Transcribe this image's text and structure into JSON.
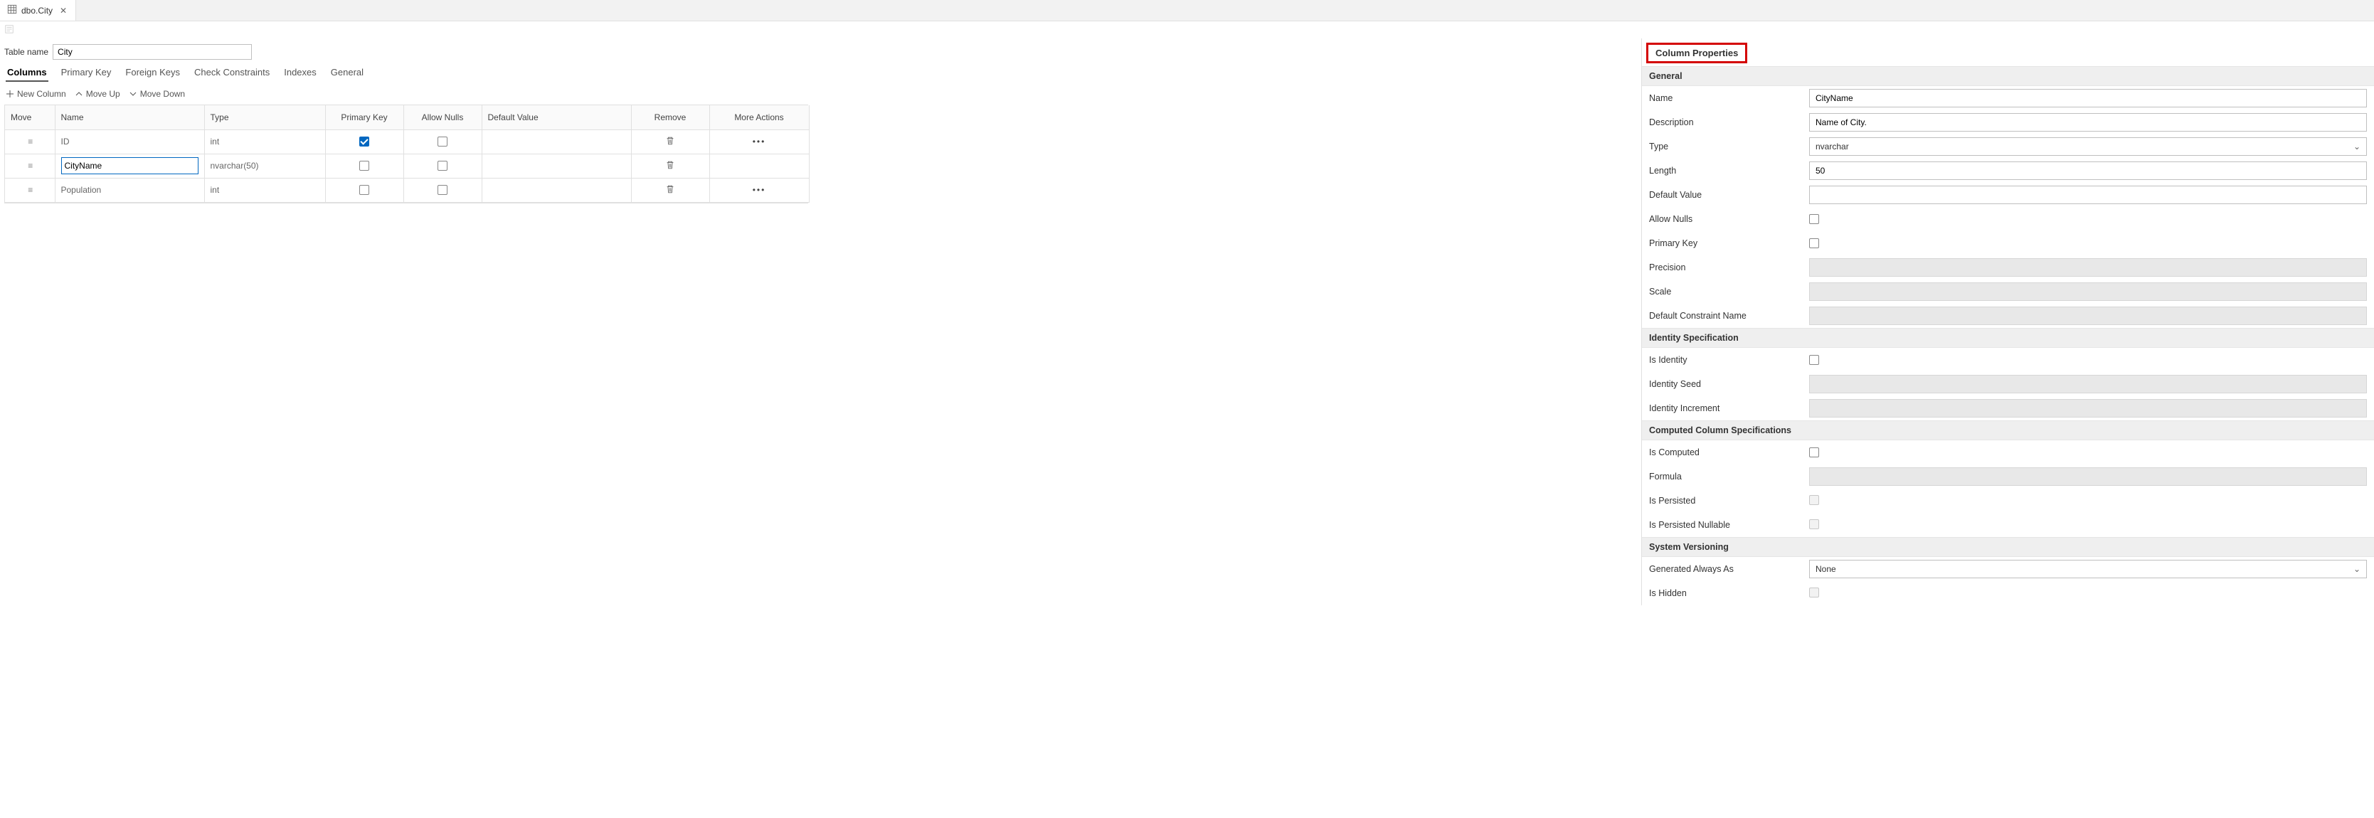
{
  "tab": {
    "title": "dbo.City"
  },
  "tableNameLabel": "Table name",
  "tableName": "City",
  "designerTabs": [
    "Columns",
    "Primary Key",
    "Foreign Keys",
    "Check Constraints",
    "Indexes",
    "General"
  ],
  "activeDesignerTab": 0,
  "colToolbar": {
    "new": "New Column",
    "moveUp": "Move Up",
    "moveDown": "Move Down"
  },
  "gridHeaders": [
    "Move",
    "Name",
    "Type",
    "Primary Key",
    "Allow Nulls",
    "Default Value",
    "Remove",
    "More Actions"
  ],
  "rows": [
    {
      "name": "ID",
      "type": "int",
      "pk": true,
      "allowNulls": false,
      "default": "",
      "editing": false,
      "moreActions": true
    },
    {
      "name": "CityName",
      "type": "nvarchar(50)",
      "pk": false,
      "allowNulls": false,
      "default": "",
      "editing": true,
      "moreActions": false
    },
    {
      "name": "Population",
      "type": "int",
      "pk": false,
      "allowNulls": false,
      "default": "",
      "editing": false,
      "moreActions": true
    }
  ],
  "rightPanelTitle": "Column Properties",
  "sections": {
    "general": "General",
    "identity": "Identity Specification",
    "computed": "Computed Column Specifications",
    "version": "System Versioning"
  },
  "props": {
    "name": {
      "label": "Name",
      "value": "CityName",
      "kind": "text"
    },
    "description": {
      "label": "Description",
      "value": "Name of City.",
      "kind": "text"
    },
    "type": {
      "label": "Type",
      "value": "nvarchar",
      "kind": "select"
    },
    "length": {
      "label": "Length",
      "value": "50",
      "kind": "text"
    },
    "defaultValue": {
      "label": "Default Value",
      "value": "",
      "kind": "text"
    },
    "allowNulls": {
      "label": "Allow Nulls",
      "value": false,
      "kind": "check"
    },
    "primaryKey": {
      "label": "Primary Key",
      "value": false,
      "kind": "check"
    },
    "precision": {
      "label": "Precision",
      "value": "",
      "kind": "disabledText"
    },
    "scale": {
      "label": "Scale",
      "value": "",
      "kind": "disabledText"
    },
    "defConstraint": {
      "label": "Default Constraint Name",
      "value": "",
      "kind": "disabledText"
    },
    "isIdentity": {
      "label": "Is Identity",
      "value": false,
      "kind": "check"
    },
    "identitySeed": {
      "label": "Identity Seed",
      "value": "",
      "kind": "disabledText"
    },
    "identityInc": {
      "label": "Identity Increment",
      "value": "",
      "kind": "disabledText"
    },
    "isComputed": {
      "label": "Is Computed",
      "value": false,
      "kind": "check"
    },
    "formula": {
      "label": "Formula",
      "value": "",
      "kind": "disabledText"
    },
    "isPersisted": {
      "label": "Is Persisted",
      "value": false,
      "kind": "disabledCheck"
    },
    "isPersistedNull": {
      "label": "Is Persisted Nullable",
      "value": false,
      "kind": "disabledCheck"
    },
    "genAlwaysAs": {
      "label": "Generated Always As",
      "value": "None",
      "kind": "select"
    },
    "isHidden": {
      "label": "Is Hidden",
      "value": false,
      "kind": "disabledCheck"
    }
  }
}
